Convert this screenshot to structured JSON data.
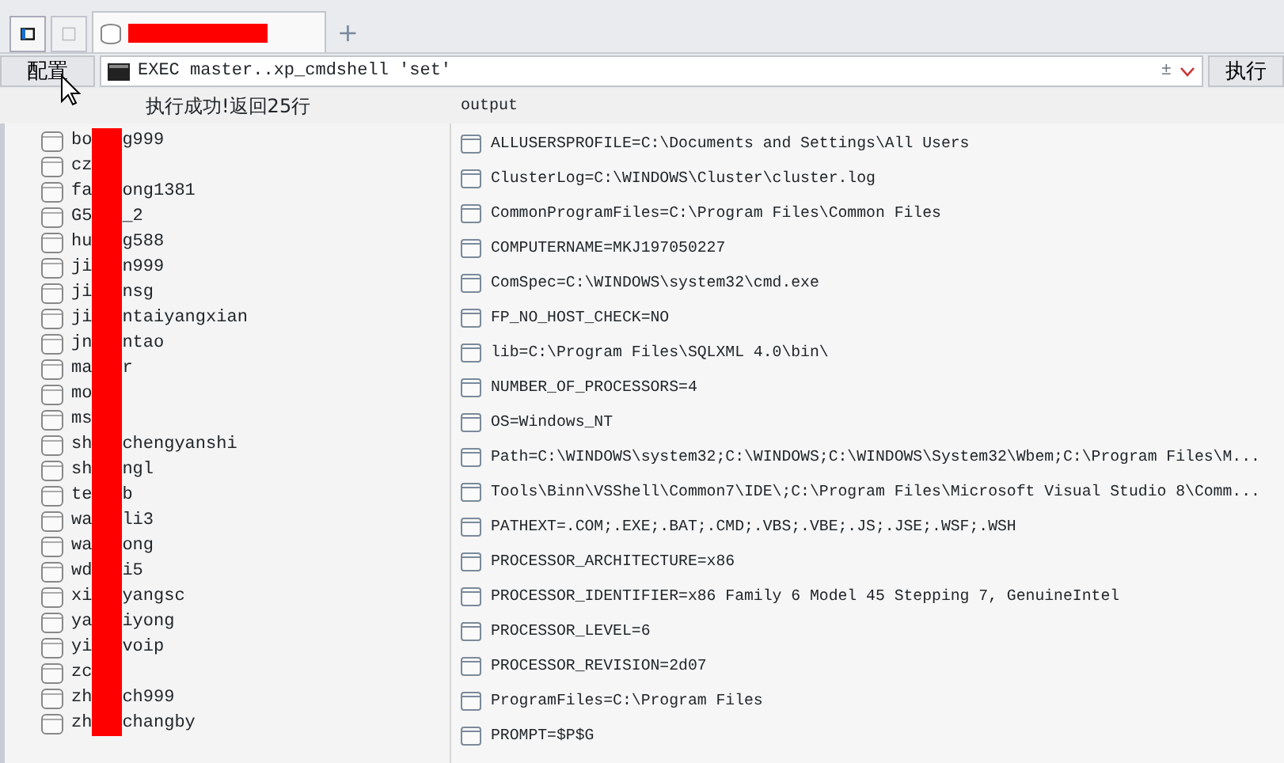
{
  "tabs": [
    {
      "selected": true
    }
  ],
  "new_tab": "+",
  "toolbar": {
    "config_button": "配置",
    "command": "EXEC master..xp_cmdshell 'set'",
    "plusminus": "±",
    "run_button": "执行"
  },
  "left_panel": {
    "header": "执行成功!返回25行",
    "rows": [
      {
        "prefix": "bo",
        "suffix": "g999"
      },
      {
        "prefix": "cz",
        "suffix": ""
      },
      {
        "prefix": "fa",
        "suffix": "ong1381"
      },
      {
        "prefix": "G5",
        "suffix": "_2"
      },
      {
        "prefix": "hu",
        "suffix": "g588"
      },
      {
        "prefix": "ji",
        "suffix": "n999"
      },
      {
        "prefix": "ji",
        "suffix": "nsg"
      },
      {
        "prefix": "ji",
        "suffix": "ntaiyangxian"
      },
      {
        "prefix": "jn",
        "suffix": "ntao"
      },
      {
        "prefix": "ma",
        "suffix": "r"
      },
      {
        "prefix": "mo",
        "suffix": ""
      },
      {
        "prefix": "ms",
        "suffix": ""
      },
      {
        "prefix": "sh",
        "suffix": "chengyanshi"
      },
      {
        "prefix": "sh",
        "suffix": "ngl"
      },
      {
        "prefix": "te",
        "suffix": "b"
      },
      {
        "prefix": "wa",
        "suffix": "li3"
      },
      {
        "prefix": "wa",
        "suffix": "ong"
      },
      {
        "prefix": "wd",
        "suffix": "i5"
      },
      {
        "prefix": "xi",
        "suffix": "yangsc"
      },
      {
        "prefix": "ya",
        "suffix": "iyong"
      },
      {
        "prefix": "yi",
        "suffix": "voip"
      },
      {
        "prefix": "zc",
        "suffix": ""
      },
      {
        "prefix": "zh",
        "suffix": "ch999"
      },
      {
        "prefix": "zh",
        "suffix": "changby"
      }
    ]
  },
  "right_panel": {
    "header": "output",
    "rows": [
      "ALLUSERSPROFILE=C:\\Documents and Settings\\All Users",
      "ClusterLog=C:\\WINDOWS\\Cluster\\cluster.log",
      "CommonProgramFiles=C:\\Program Files\\Common Files",
      "COMPUTERNAME=MKJ197050227",
      "ComSpec=C:\\WINDOWS\\system32\\cmd.exe",
      "FP_NO_HOST_CHECK=NO",
      "lib=C:\\Program Files\\SQLXML 4.0\\bin\\",
      "NUMBER_OF_PROCESSORS=4",
      "OS=Windows_NT",
      "Path=C:\\WINDOWS\\system32;C:\\WINDOWS;C:\\WINDOWS\\System32\\Wbem;C:\\Program Files\\M...",
      "Tools\\Binn\\VSShell\\Common7\\IDE\\;C:\\Program Files\\Microsoft Visual Studio 8\\Comm...",
      "PATHEXT=.COM;.EXE;.BAT;.CMD;.VBS;.VBE;.JS;.JSE;.WSF;.WSH",
      "PROCESSOR_ARCHITECTURE=x86",
      "PROCESSOR_IDENTIFIER=x86 Family 6 Model 45 Stepping 7, GenuineIntel",
      "PROCESSOR_LEVEL=6",
      "PROCESSOR_REVISION=2d07",
      "ProgramFiles=C:\\Program Files",
      "PROMPT=$P$G"
    ]
  }
}
